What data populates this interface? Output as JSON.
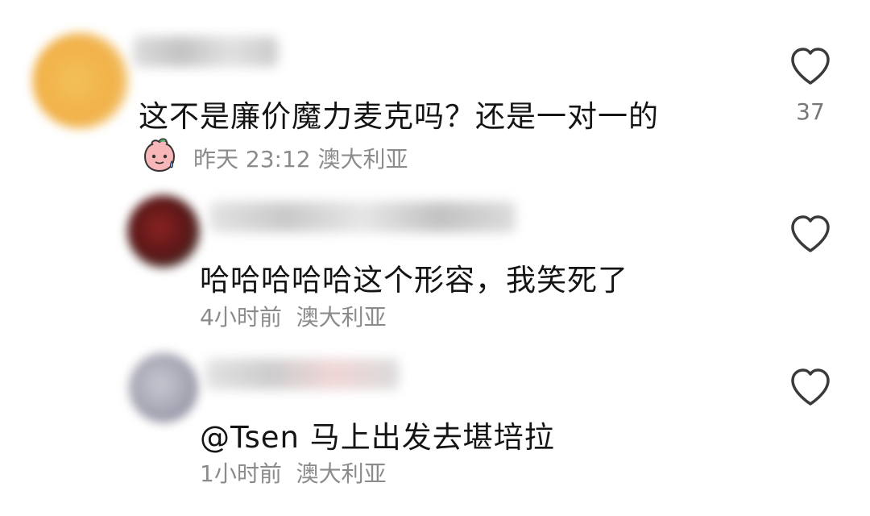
{
  "comments": [
    {
      "text": "这不是廉价魔力麦克吗？还是一对一的",
      "time": "昨天 23:12",
      "location": "澳大利亚",
      "likes": "37",
      "has_badge": true,
      "avatar_color": "#f2b54a"
    },
    {
      "text": "哈哈哈哈哈这个形容，我笑死了",
      "time": "4小时前",
      "location": "澳大利亚",
      "likes": "",
      "avatar_color": "#7a1f1f"
    },
    {
      "text": "@Tsen  马上出发去堪培拉",
      "time": "1小时前",
      "location": "澳大利亚",
      "likes": "",
      "avatar_color": "#b8b8c4"
    }
  ],
  "icons": {
    "like": "heart-outline-icon",
    "badge": "peach-emoji-icon"
  },
  "colors": {
    "text": "#141414",
    "meta": "#8b8b8b",
    "icon": "#3a3a3a"
  }
}
